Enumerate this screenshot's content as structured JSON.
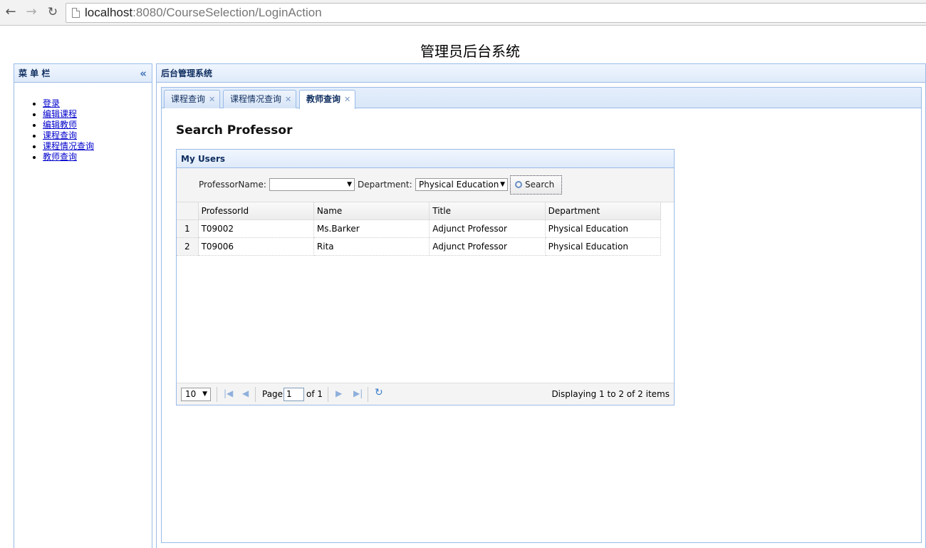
{
  "browser": {
    "url_host": "localhost",
    "url_rest": ":8080/CourseSelection/LoginAction"
  },
  "page": {
    "title": "管理员后台系统"
  },
  "west": {
    "title": "菜 单 栏",
    "collapse_icon": "«",
    "menu": [
      "登录",
      "编辑课程",
      "编辑教师",
      "课程查询",
      "课程情况查询",
      "教师查询"
    ]
  },
  "center": {
    "title": "后台管理系统",
    "tabs": [
      {
        "label": "课程查询"
      },
      {
        "label": "课程情况查询"
      },
      {
        "label": "教师查询",
        "active": true
      }
    ],
    "content_title": "Search Professor"
  },
  "grid": {
    "title": "My Users",
    "professor_label": "ProfessorName:",
    "professor_value": "",
    "department_label": "Department:",
    "department_value": "Physical Education",
    "search_label": "Search",
    "columns": [
      "ProfessorId",
      "Name",
      "Title",
      "Department"
    ],
    "rows": [
      {
        "num": "1",
        "cells": [
          "T09002",
          "Ms.Barker",
          "Adjunct Professor",
          "Physical Education"
        ]
      },
      {
        "num": "2",
        "cells": [
          "T09006",
          "Rita",
          "Adjunct Professor",
          "Physical Education"
        ]
      }
    ],
    "pager": {
      "page_size": "10",
      "page_label": "Page",
      "page_value": "1",
      "of_label": "of 1",
      "display": "Displaying 1 to 2 of 2 items"
    }
  }
}
